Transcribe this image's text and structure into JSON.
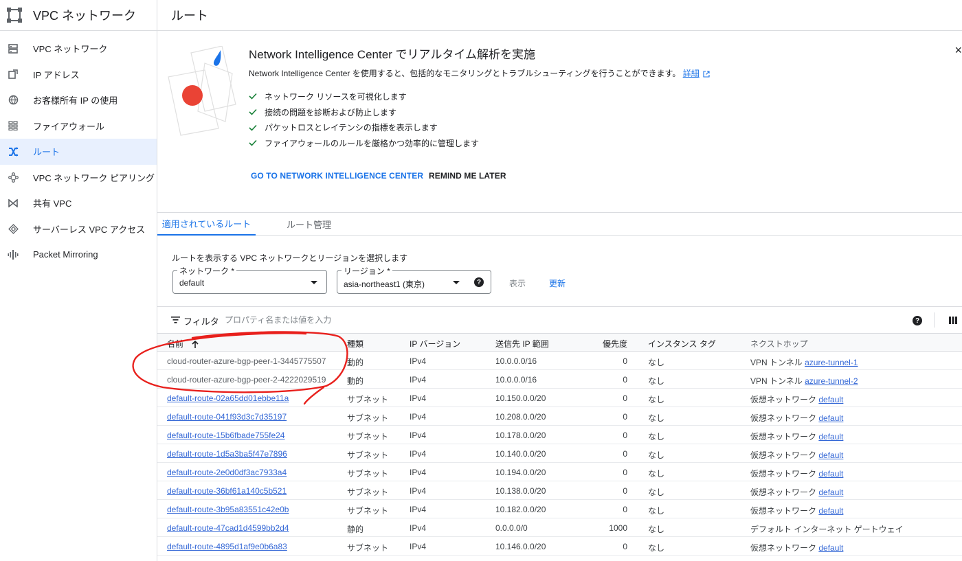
{
  "sidebar": {
    "title": "VPC ネットワーク",
    "items": [
      {
        "label": "VPC ネットワーク",
        "icon": "vpc-network-icon"
      },
      {
        "label": "IP アドレス",
        "icon": "ip-address-icon"
      },
      {
        "label": "お客様所有 IP の使用",
        "icon": "globe-icon"
      },
      {
        "label": "ファイアウォール",
        "icon": "firewall-icon"
      },
      {
        "label": "ルート",
        "icon": "routes-icon",
        "active": true
      },
      {
        "label": "VPC ネットワーク ピアリング",
        "icon": "peering-icon"
      },
      {
        "label": "共有 VPC",
        "icon": "shared-vpc-icon"
      },
      {
        "label": "サーバーレス VPC アクセス",
        "icon": "serverless-icon"
      },
      {
        "label": "Packet Mirroring",
        "icon": "packet-mirroring-icon"
      }
    ]
  },
  "header": {
    "title": "ルート"
  },
  "banner": {
    "title": "Network Intelligence Center でリアルタイム解析を実施",
    "description": "Network Intelligence Center を使用すると、包括的なモニタリングとトラブルシューティングを行うことができます。",
    "learn_more": "詳細",
    "bullets": [
      "ネットワーク リソースを可視化します",
      "接続の問題を診断および防止します",
      "パケットロスとレイテンシの指標を表示します",
      "ファイアウォールのルールを厳格かつ効率的に管理します"
    ],
    "go_button": "GO TO NETWORK INTELLIGENCE CENTER",
    "remind_button": "REMIND ME LATER",
    "close": "×"
  },
  "tabs": [
    {
      "label": "適用されているルート",
      "active": true
    },
    {
      "label": "ルート管理"
    }
  ],
  "selector": {
    "caption": "ルートを表示する VPC ネットワークとリージョンを選択します",
    "network_label": "ネットワーク *",
    "network_value": "default",
    "region_label": "リージョン *",
    "region_value": "asia-northeast1 (東京)",
    "help": "?",
    "show": "表示",
    "refresh": "更新"
  },
  "filter": {
    "label": "フィルタ",
    "placeholder": "プロパティ名または値を入力",
    "help": "?"
  },
  "table": {
    "headers": {
      "name": "名前",
      "type": "種類",
      "ip_version": "IP バージョン",
      "dest": "送信先 IP 範囲",
      "priority": "優先度",
      "tag": "インスタンス タグ",
      "next_hop": "ネクストホップ"
    },
    "rows": [
      {
        "name": "cloud-router-azure-bgp-peer-1-3445775507",
        "link": false,
        "type": "動的",
        "ipv": "IPv4",
        "dest": "10.0.0.0/16",
        "pri": "0",
        "tag": "なし",
        "hop_prefix": "VPN トンネル",
        "hop_link": "azure-tunnel-1"
      },
      {
        "name": "cloud-router-azure-bgp-peer-2-4222029519",
        "link": false,
        "type": "動的",
        "ipv": "IPv4",
        "dest": "10.0.0.0/16",
        "pri": "0",
        "tag": "なし",
        "hop_prefix": "VPN トンネル",
        "hop_link": "azure-tunnel-2"
      },
      {
        "name": "default-route-02a65dd01ebbe11a",
        "link": true,
        "type": "サブネット",
        "ipv": "IPv4",
        "dest": "10.150.0.0/20",
        "pri": "0",
        "tag": "なし",
        "hop_prefix": "仮想ネットワーク",
        "hop_link": "default"
      },
      {
        "name": "default-route-041f93d3c7d35197",
        "link": true,
        "type": "サブネット",
        "ipv": "IPv4",
        "dest": "10.208.0.0/20",
        "pri": "0",
        "tag": "なし",
        "hop_prefix": "仮想ネットワーク",
        "hop_link": "default"
      },
      {
        "name": "default-route-15b6fbade755fe24",
        "link": true,
        "type": "サブネット",
        "ipv": "IPv4",
        "dest": "10.178.0.0/20",
        "pri": "0",
        "tag": "なし",
        "hop_prefix": "仮想ネットワーク",
        "hop_link": "default"
      },
      {
        "name": "default-route-1d5a3ba5f47e7896",
        "link": true,
        "type": "サブネット",
        "ipv": "IPv4",
        "dest": "10.140.0.0/20",
        "pri": "0",
        "tag": "なし",
        "hop_prefix": "仮想ネットワーク",
        "hop_link": "default"
      },
      {
        "name": "default-route-2e0d0df3ac7933a4",
        "link": true,
        "type": "サブネット",
        "ipv": "IPv4",
        "dest": "10.194.0.0/20",
        "pri": "0",
        "tag": "なし",
        "hop_prefix": "仮想ネットワーク",
        "hop_link": "default"
      },
      {
        "name": "default-route-36bf61a140c5b521",
        "link": true,
        "type": "サブネット",
        "ipv": "IPv4",
        "dest": "10.138.0.0/20",
        "pri": "0",
        "tag": "なし",
        "hop_prefix": "仮想ネットワーク",
        "hop_link": "default"
      },
      {
        "name": "default-route-3b95a83551c42e0b",
        "link": true,
        "type": "サブネット",
        "ipv": "IPv4",
        "dest": "10.182.0.0/20",
        "pri": "0",
        "tag": "なし",
        "hop_prefix": "仮想ネットワーク",
        "hop_link": "default"
      },
      {
        "name": "default-route-47cad1d4599bb2d4",
        "link": true,
        "type": "静的",
        "ipv": "IPv4",
        "dest": "0.0.0.0/0",
        "pri": "1000",
        "tag": "なし",
        "hop_prefix": "デフォルト インターネット ゲートウェイ",
        "hop_link": ""
      },
      {
        "name": "default-route-4895d1af9e0b6a83",
        "link": true,
        "type": "サブネット",
        "ipv": "IPv4",
        "dest": "10.146.0.0/20",
        "pri": "0",
        "tag": "なし",
        "hop_prefix": "仮想ネットワーク",
        "hop_link": "default"
      }
    ]
  },
  "colors": {
    "accent": "#1a73e8",
    "active_bg": "#e8f0fe",
    "annotation": "#e8201c"
  }
}
